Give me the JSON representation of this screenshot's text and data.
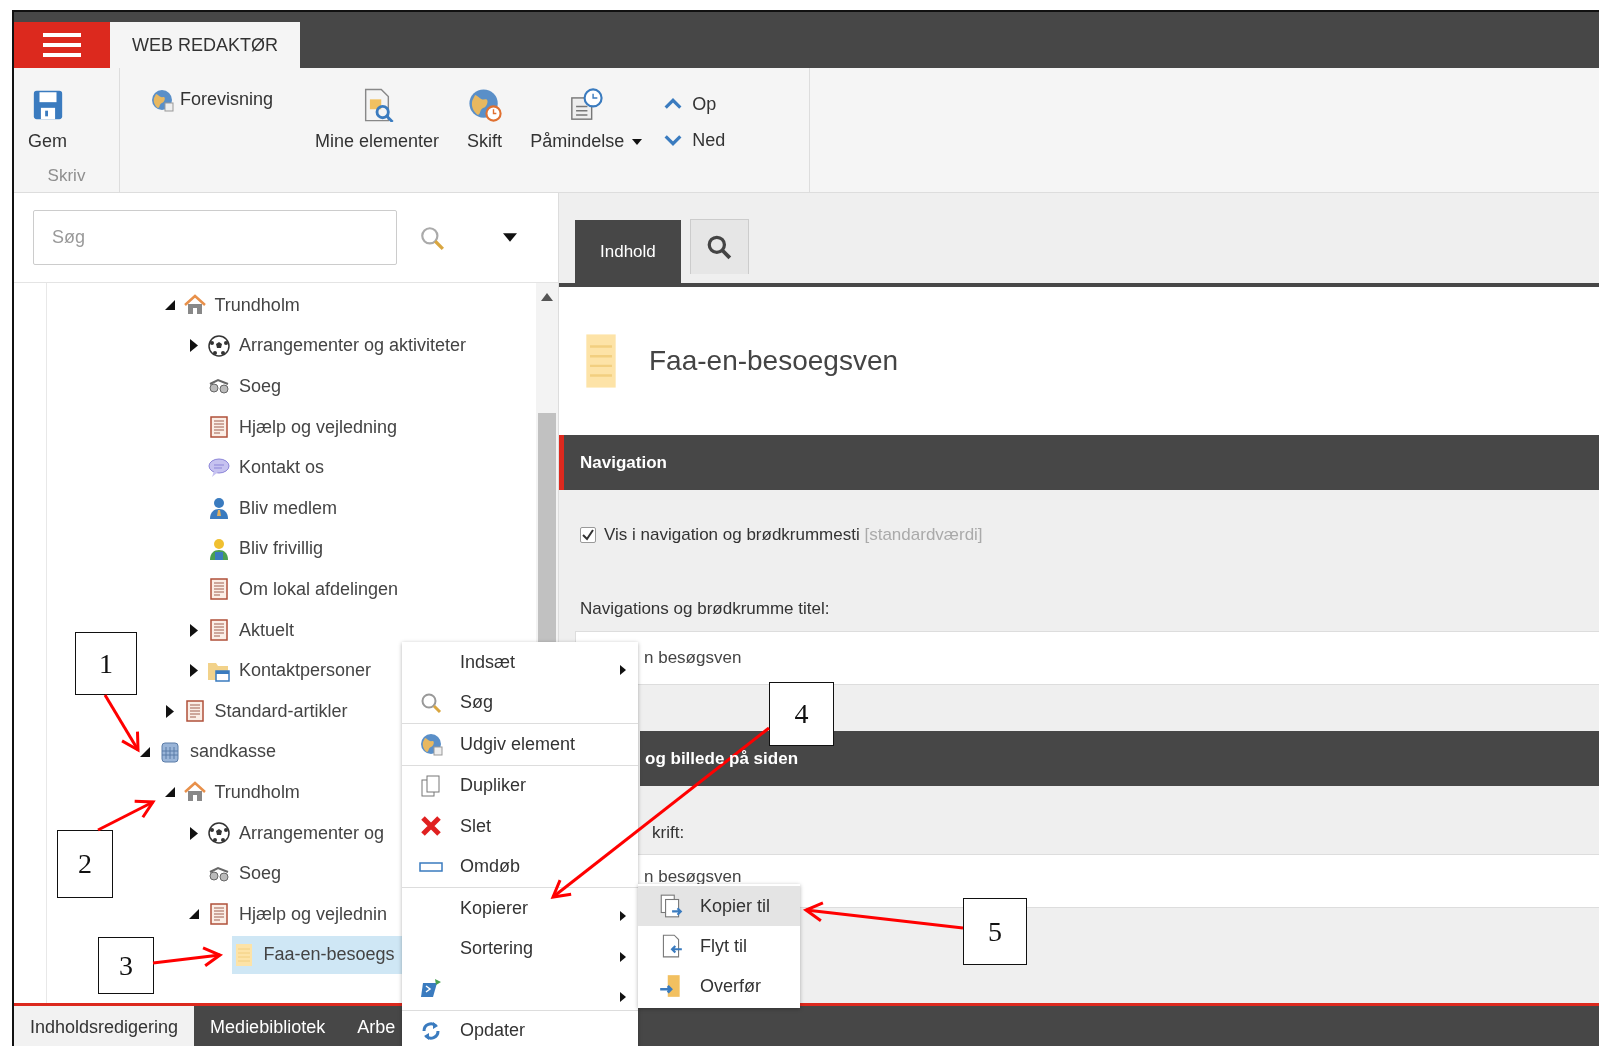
{
  "app_bar": {
    "tabs": [
      {
        "label": "WEB REDAKTØR",
        "selected": true
      }
    ]
  },
  "ribbon": {
    "groups": [
      {
        "label": "Skriv",
        "buttons": [
          {
            "label": "Gem"
          }
        ]
      },
      {
        "buttons": [
          {
            "label": "Forevisning"
          },
          {
            "label": "Mine elementer"
          },
          {
            "label": "Skift"
          },
          {
            "label": "Påmindelse",
            "dropdown": true
          },
          {
            "label": "Op"
          },
          {
            "label": "Ned"
          }
        ]
      }
    ]
  },
  "search": {
    "placeholder": "Søg"
  },
  "tree": {
    "upper_branch": [
      {
        "label": "Trundholm",
        "kind": "home",
        "expanded": true,
        "children": [
          {
            "label": "Arrangementer og aktiviteter",
            "kind": "ball",
            "expanded": false
          },
          {
            "label": "Soeg",
            "kind": "binoculars"
          },
          {
            "label": "Hjælp og vejledning",
            "kind": "article"
          },
          {
            "label": "Kontakt os",
            "kind": "speech"
          },
          {
            "label": "Bliv medlem",
            "kind": "member"
          },
          {
            "label": "Bliv frivillig",
            "kind": "volunteer"
          },
          {
            "label": "Om lokal afdelingen",
            "kind": "article"
          },
          {
            "label": "Aktuelt",
            "kind": "article",
            "expanded": false
          },
          {
            "label": "Kontaktpersoner",
            "kind": "folder",
            "expanded": false
          }
        ]
      },
      {
        "label": "Standard-artikler",
        "kind": "article",
        "expanded": false
      }
    ],
    "items": [
      {
        "label": "sandkasse",
        "kind": "database",
        "expanded": true,
        "children": [
          {
            "label": "Trundholm",
            "kind": "home",
            "expanded": true,
            "children": [
              {
                "label": "Arrangementer og",
                "kind": "ball",
                "expanded": false
              },
              {
                "label": "Soeg",
                "kind": "binoculars"
              },
              {
                "label": "Hjælp og vejlednin",
                "kind": "article",
                "expanded": true,
                "children": [
                  {
                    "label": "Faa-en-besoegs",
                    "kind": "note",
                    "selected": true
                  }
                ]
              }
            ]
          }
        ]
      }
    ]
  },
  "editor": {
    "tabs": [
      {
        "label": "Indhold",
        "kind": "text",
        "selected": true
      },
      {
        "kind": "search",
        "selected": false
      }
    ],
    "item_title": "Faa-en-besoegsven",
    "sections": [
      {
        "title": "Navigation",
        "active": true,
        "fields": [
          {
            "kind": "checkbox",
            "label": "Vis i navigation og brødkrummesti",
            "hint": "[standardværdi]",
            "checked": true
          },
          {
            "kind": "text",
            "label": "Navigations og brødkrumme titel:",
            "value": "n besøgsven"
          }
        ]
      },
      {
        "title": "og billede på siden",
        "fields": [
          {
            "kind": "text",
            "label": "krift:",
            "value": "n besøgsven"
          }
        ]
      }
    ]
  },
  "bottom_tabs": [
    {
      "label": "Indholdsredigering",
      "selected": true
    },
    {
      "label": "Mediebibliotek",
      "selected": false
    },
    {
      "label": "Arbe",
      "selected": false
    }
  ],
  "context_menu": {
    "items": [
      {
        "label": "Indsæt",
        "submenu": true
      },
      {
        "label": "Søg",
        "kind": "search"
      },
      {
        "label": "Udgiv element",
        "kind": "globe",
        "separator_before": true
      },
      {
        "label": "Dupliker",
        "kind": "duplicate",
        "separator_before": true
      },
      {
        "label": "Slet",
        "kind": "delete"
      },
      {
        "label": "Omdøb",
        "kind": "rename"
      },
      {
        "label": "Kopierer",
        "submenu": true,
        "separator_before": true
      },
      {
        "label": "Sortering",
        "submenu": true
      },
      {
        "kind": "script",
        "submenu": true
      },
      {
        "label": "Opdater",
        "kind": "refresh",
        "separator_before": true
      }
    ],
    "submenu": [
      {
        "label": "Kopier til",
        "kind": "copy-to",
        "selected": true
      },
      {
        "label": "Flyt til",
        "kind": "move-to",
        "selected": false
      },
      {
        "label": "Overfør",
        "kind": "transfer",
        "selected": false
      }
    ]
  },
  "callouts": [
    {
      "label": "1"
    },
    {
      "label": "2"
    },
    {
      "label": "3"
    },
    {
      "label": "4"
    },
    {
      "label": "5"
    }
  ]
}
